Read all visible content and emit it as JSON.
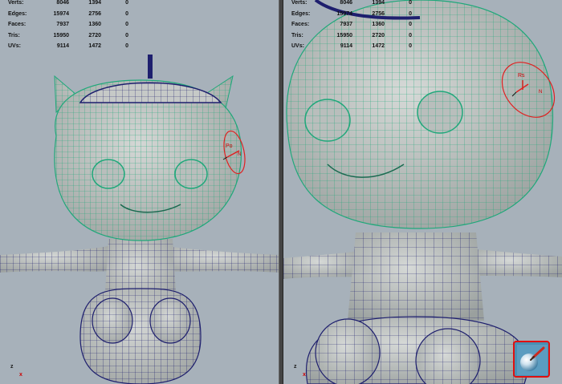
{
  "hud": {
    "rows": [
      {
        "label": "Verts:",
        "v1": "8046",
        "v2": "1394",
        "v3": "0"
      },
      {
        "label": "Edges:",
        "v1": "15974",
        "v2": "2756",
        "v3": "0"
      },
      {
        "label": "Faces:",
        "v1": "7937",
        "v2": "1360",
        "v3": "0"
      },
      {
        "label": "Tris:",
        "v1": "15950",
        "v2": "2720",
        "v3": "0"
      },
      {
        "label": "UVs:",
        "v1": "9114",
        "v2": "1472",
        "v3": "0"
      }
    ]
  },
  "axis": {
    "x": "x",
    "z": "z"
  },
  "manipulator_left": {
    "label": "Po",
    "dir": "N"
  },
  "manipulator_right": {
    "label": "Rs",
    "dir": "N"
  },
  "colors": {
    "viewport_bg": "#a7b1ba",
    "wire_green": "#1fa87a",
    "wire_blue": "#1e1f6e",
    "mesh": "#c6c9c7",
    "manipulator": "#e02020",
    "tool_border": "#e01010"
  },
  "tool": {
    "icon": "sculpt-brush-icon"
  }
}
